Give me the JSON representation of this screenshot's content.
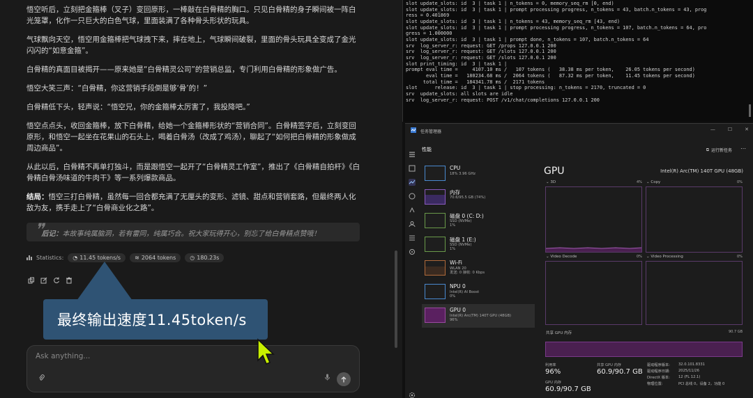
{
  "story": {
    "p1": "悟空听后，立刻把金箍棒（叉子）变回原形，一棒敲在白骨精的胸口。只见白骨精的身子瞬间被一阵白光笼罩，化作一只巨大的白色气球，里面装满了各种骨头形状的玩具。",
    "p2": "气球飘向天空，悟空用金箍棒把气球拽下来，摔在地上，气球瞬间破裂，里面的骨头玩具全变成了金光闪闪的“如意金箍”。",
    "p3": "白骨精的真面目被揭开——原来她是“白骨精灵公司”的营销总监，专门利用白骨精的形象做广告。",
    "p4": "悟空大笑三声：“白骨精，你这营销手段倒是够‘骨’的！”",
    "p5": "白骨精低下头，轻声说：“悟空兄，你的金箍棒太厉害了，我投降吧。”",
    "p6": "悟空点点头，收回金箍棒，放下白骨精，给她一个金箍棒形状的“营销合同”。白骨精签字后，立刻变回原形，和悟空一起坐在花果山的石头上，喝着白骨汤（改成了鸡汤），聊起了“如何把白骨精的形象做成周边商品”。",
    "p7": "从此以后，白骨精不再单打独斗，而是跟悟空一起开了“白骨精灵工作室”，推出了《白骨精自拍杆》《白骨精白骨汤味道的牛肉干》等一系列爆款商品。",
    "p8_bold": "结局：",
    "p8": "悟空三打白骨精，虽然每一回合都充满了无厘头的变形、滤镜、甜点和营销套路，但最终两人化敌为友，携手走上了“白骨商业化之路”。",
    "quote_bold": "后记：",
    "quote": "本故事纯属脑洞，若有雷同，纯属巧合。祝大家玩得开心，别忘了给白骨精点赞哦！"
  },
  "stats": {
    "label": "Statistics:",
    "speed": "11.45 tokens/s",
    "tokens": "2064 tokens",
    "time": "180.23s"
  },
  "callout": "最终输出速度11.45token/s",
  "input": {
    "placeholder": "Ask anything..."
  },
  "terminal": {
    "lines": [
      "slot update_slots: id  3 | task 1 | n_tokens = 0, memory_seq_rm [0, end)",
      "slot update_slots: id  3 | task 1 | prompt processing progress, n_tokens = 43, batch.n_tokens = 43, prog",
      "ress = 0.401869",
      "slot update_slots: id  3 | task 1 | n_tokens = 43, memory_seq_rm [43, end)",
      "slot update_slots: id  3 | task 1 | prompt processing progress, n_tokens = 107, batch.n_tokens = 64, pro",
      "gress = 1.000000",
      "slot update_slots: id  3 | task 1 | prompt done, n_tokens = 107, batch.n_tokens = 64",
      "srv  log_server_r: request: GET /props 127.0.0.1 200",
      "srv  log_server_r: request: GET /slots 127.0.0.1 200",
      "srv  log_server_r: request: GET /slots 127.0.0.1 200",
      "slot print_timing: id  3 | task 1 |",
      "prompt eval time =     4107.10 ms /   107 tokens (   38.38 ms per token,    26.05 tokens per second)",
      "       eval time =   180234.68 ms /  2064 tokens (   87.32 ms per token,    11.45 tokens per second)",
      "      total time =   184341.78 ms /  2171 tokens",
      "slot      release: id  3 | task 1 | stop processing: n_tokens = 2170, truncated = 0",
      "srv  update_slots: all slots are idle",
      "srv  log_server_r: request: POST /v1/chat/completions 127.0.0.1 200"
    ]
  },
  "taskmgr": {
    "title": "任务管理器",
    "section": "性能",
    "run_task": "运行新任务",
    "devices": [
      {
        "name": "CPU",
        "sub1": "18% 3.96 GHz",
        "sub2": ""
      },
      {
        "name": "内存",
        "sub1": "70.6/95.5 GB (74%)",
        "sub2": ""
      },
      {
        "name": "磁盘 0 (C: D:)",
        "sub1": "SSD (NVMe)",
        "sub2": "1%"
      },
      {
        "name": "磁盘 1 (E:)",
        "sub1": "SSD (NVMe)",
        "sub2": "1%"
      },
      {
        "name": "Wi-Fi",
        "sub1": "WLAN 20",
        "sub2": "发送: 0 接收: 0 Kbps"
      },
      {
        "name": "NPU 0",
        "sub1": "Intel(R) AI Boost",
        "sub2": "0%"
      },
      {
        "name": "GPU 0",
        "sub1": "Intel(R) Arc(TM) 140T GPU (48GB)",
        "sub2": "96%"
      }
    ],
    "gpu_title": "GPU",
    "gpu_model": "Intel(R) Arc(TM) 140T GPU (48GB)",
    "graphs": [
      {
        "name": "3D",
        "pct": "4%"
      },
      {
        "name": "Copy",
        "pct": "0%"
      },
      {
        "name": "Video Decode",
        "pct": "0%"
      },
      {
        "name": "Video Processing",
        "pct": "0%"
      }
    ],
    "shared_mem_label": "共享 GPU 内存",
    "shared_mem_max": "90.7 GB",
    "util_label": "利用率",
    "util_value": "96%",
    "shared_label": "共享 GPU 内存",
    "shared_value": "60.9/90.7 GB",
    "gpu_mem_label": "GPU 内存",
    "gpu_mem_value": "60.9/90.7 GB",
    "info": [
      {
        "k": "驱动程序版本:",
        "v": "32.0.101.8331"
      },
      {
        "k": "驱动程序日期:",
        "v": "2025/11/26"
      },
      {
        "k": "DirectX 版本:",
        "v": "12 (FL 12.1)"
      },
      {
        "k": "物理位置:",
        "v": "PCI 总线 0，设备 2，功能 0"
      }
    ]
  }
}
